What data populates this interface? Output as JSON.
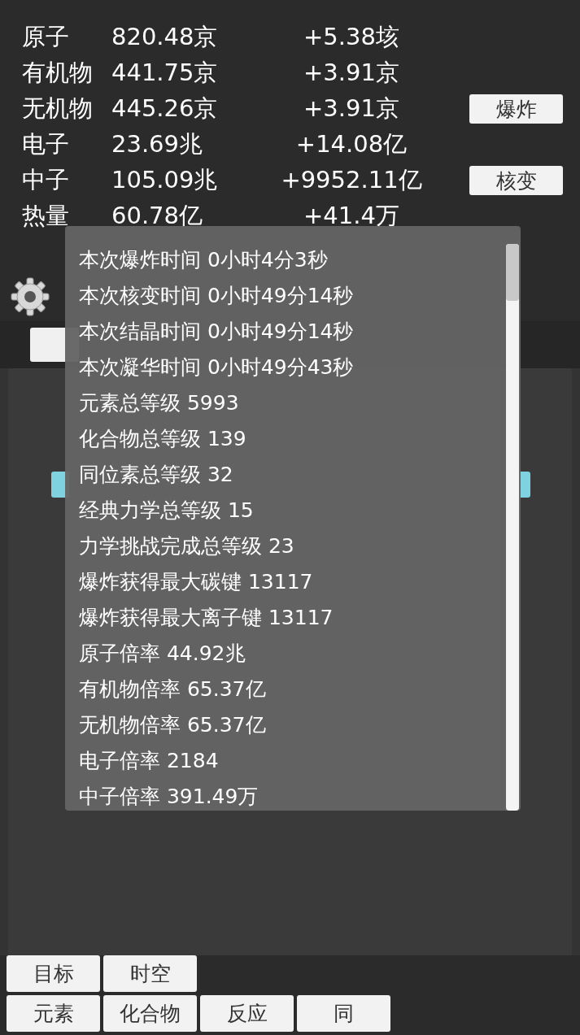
{
  "resources": [
    {
      "name": "原子",
      "amount": "820.48京",
      "rate": "+5.38垓"
    },
    {
      "name": "有机物",
      "amount": "441.75京",
      "rate": "+3.91京"
    },
    {
      "name": "无机物",
      "amount": "445.26京",
      "rate": "+3.91京"
    },
    {
      "name": "电子",
      "amount": "23.69兆",
      "rate": "+14.08亿"
    },
    {
      "name": "中子",
      "amount": "105.09兆",
      "rate": "+9952.11亿"
    },
    {
      "name": "热量",
      "amount": "60.78亿",
      "rate": "+41.4万"
    }
  ],
  "side_buttons": [
    "爆炸",
    "核变"
  ],
  "stats_popup": {
    "lines": [
      "本次爆炸时间 0小时4分3秒",
      "本次核变时间 0小时49分14秒",
      "本次结晶时间 0小时49分14秒",
      "本次凝华时间 0小时49分43秒",
      "元素总等级 5993",
      "化合物总等级 139",
      "同位素总等级 32",
      "经典力学总等级 15",
      "力学挑战完成总等级 23",
      "爆炸获得最大碳键 13117",
      "爆炸获得最大离子键 13117",
      "原子倍率 44.92兆",
      "有机物倍率 65.37亿",
      "无机物倍率 65.37亿",
      "电子倍率 2184",
      "中子倍率 391.49万"
    ]
  },
  "nav": [
    [
      "目标",
      "时空"
    ],
    [
      "元素",
      "化合物",
      "反应",
      "同"
    ]
  ]
}
